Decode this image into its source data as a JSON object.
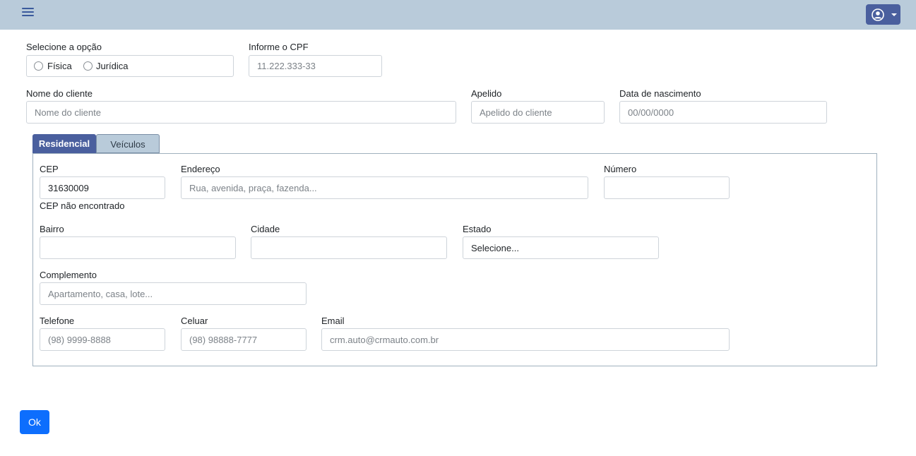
{
  "header": {
    "menu_icon": "hamburger-menu-icon",
    "user_icon": "user-circle-icon",
    "accent_color": "#b9cbda",
    "user_button_color": "#4a5f9e"
  },
  "person_type": {
    "label": "Selecione a opção",
    "options": [
      "Física",
      "Jurídica"
    ]
  },
  "cpf": {
    "label": "Informe o CPF",
    "placeholder": "11.222.333-33"
  },
  "client_name": {
    "label": "Nome do cliente",
    "placeholder": "Nome do cliente"
  },
  "nickname": {
    "label": "Apelido",
    "placeholder": "Apelido do cliente"
  },
  "birth_date": {
    "label": "Data de nascimento",
    "placeholder": "00/00/0000"
  },
  "tabs": [
    {
      "label": "Residencial",
      "active": true
    },
    {
      "label": "Veículos",
      "active": false
    }
  ],
  "address": {
    "cep": {
      "label": "CEP",
      "value": "31630009",
      "message": "CEP não encontrado"
    },
    "street": {
      "label": "Endereço",
      "placeholder": "Rua, avenida, praça, fazenda..."
    },
    "number": {
      "label": "Número",
      "value": ""
    },
    "district": {
      "label": "Bairro",
      "value": ""
    },
    "city": {
      "label": "Cidade",
      "value": ""
    },
    "state": {
      "label": "Estado",
      "selected": "Selecione..."
    },
    "complement": {
      "label": "Complemento",
      "placeholder": "Apartamento, casa, lote..."
    },
    "phone": {
      "label": "Telefone",
      "placeholder": "(98) 9999-8888"
    },
    "cellphone": {
      "label": "Celuar",
      "placeholder": "(98) 98888-7777"
    },
    "email": {
      "label": "Email",
      "placeholder": "crm.auto@crmauto.com.br"
    }
  },
  "actions": {
    "ok_label": "Ok",
    "ok_color": "#0d6efd"
  }
}
